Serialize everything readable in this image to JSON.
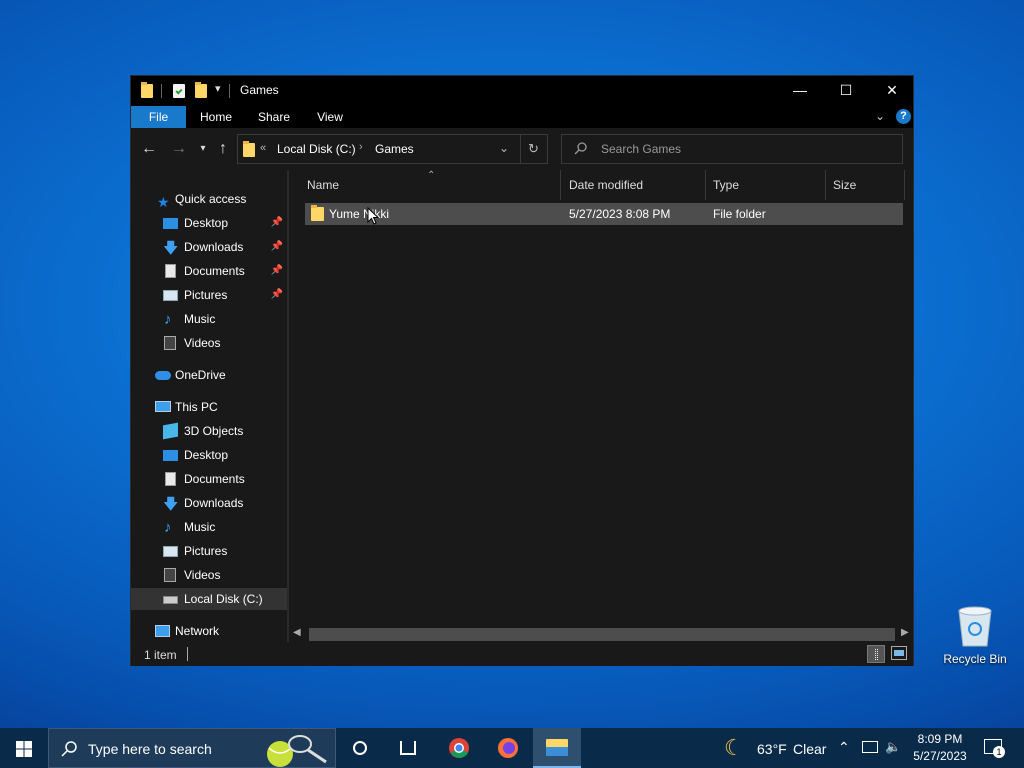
{
  "window": {
    "title": "Games",
    "controls": {
      "minimize": "—",
      "maximize": "☐",
      "close": "✕"
    }
  },
  "ribbon": {
    "tabs": [
      "File",
      "Home",
      "Share",
      "View"
    ],
    "help": "?"
  },
  "address": {
    "overflow": "«",
    "crumbs": [
      "Local Disk (C:)",
      "Games"
    ]
  },
  "search": {
    "placeholder": "Search Games"
  },
  "sidebar": {
    "quick_access": "Quick access",
    "quick_items": [
      {
        "label": "Desktop",
        "icon": "desktop-icon",
        "pinned": true
      },
      {
        "label": "Downloads",
        "icon": "downloads-icon",
        "pinned": true
      },
      {
        "label": "Documents",
        "icon": "documents-icon",
        "pinned": true
      },
      {
        "label": "Pictures",
        "icon": "pictures-icon",
        "pinned": true
      },
      {
        "label": "Music",
        "icon": "music-icon",
        "pinned": false
      },
      {
        "label": "Videos",
        "icon": "videos-icon",
        "pinned": false
      }
    ],
    "onedrive": "OneDrive",
    "this_pc": "This PC",
    "pc_items": [
      {
        "label": "3D Objects",
        "icon": "3d-objects-icon"
      },
      {
        "label": "Desktop",
        "icon": "desktop-icon"
      },
      {
        "label": "Documents",
        "icon": "documents-icon"
      },
      {
        "label": "Downloads",
        "icon": "downloads-icon"
      },
      {
        "label": "Music",
        "icon": "music-icon"
      },
      {
        "label": "Pictures",
        "icon": "pictures-icon"
      },
      {
        "label": "Videos",
        "icon": "videos-icon"
      },
      {
        "label": "Local Disk (C:)",
        "icon": "drive-icon",
        "selected": true
      }
    ],
    "network": "Network"
  },
  "columns": [
    "Name",
    "Date modified",
    "Type",
    "Size"
  ],
  "files": [
    {
      "name": "Yume Nikki",
      "date": "5/27/2023 8:08 PM",
      "type": "File folder",
      "size": ""
    }
  ],
  "status": {
    "count": "1 item"
  },
  "desktop": {
    "recycle_bin": "Recycle Bin"
  },
  "taskbar": {
    "search_placeholder": "Type here to search",
    "weather": {
      "temp": "63°F",
      "condition": "Clear"
    },
    "time": "8:09 PM",
    "date": "5/27/2023",
    "notification_count": "1"
  },
  "colors": {
    "accent": "#1979ca",
    "folder": "#ffd767",
    "selection": "#4d4d4d",
    "window_bg": "#191919"
  }
}
